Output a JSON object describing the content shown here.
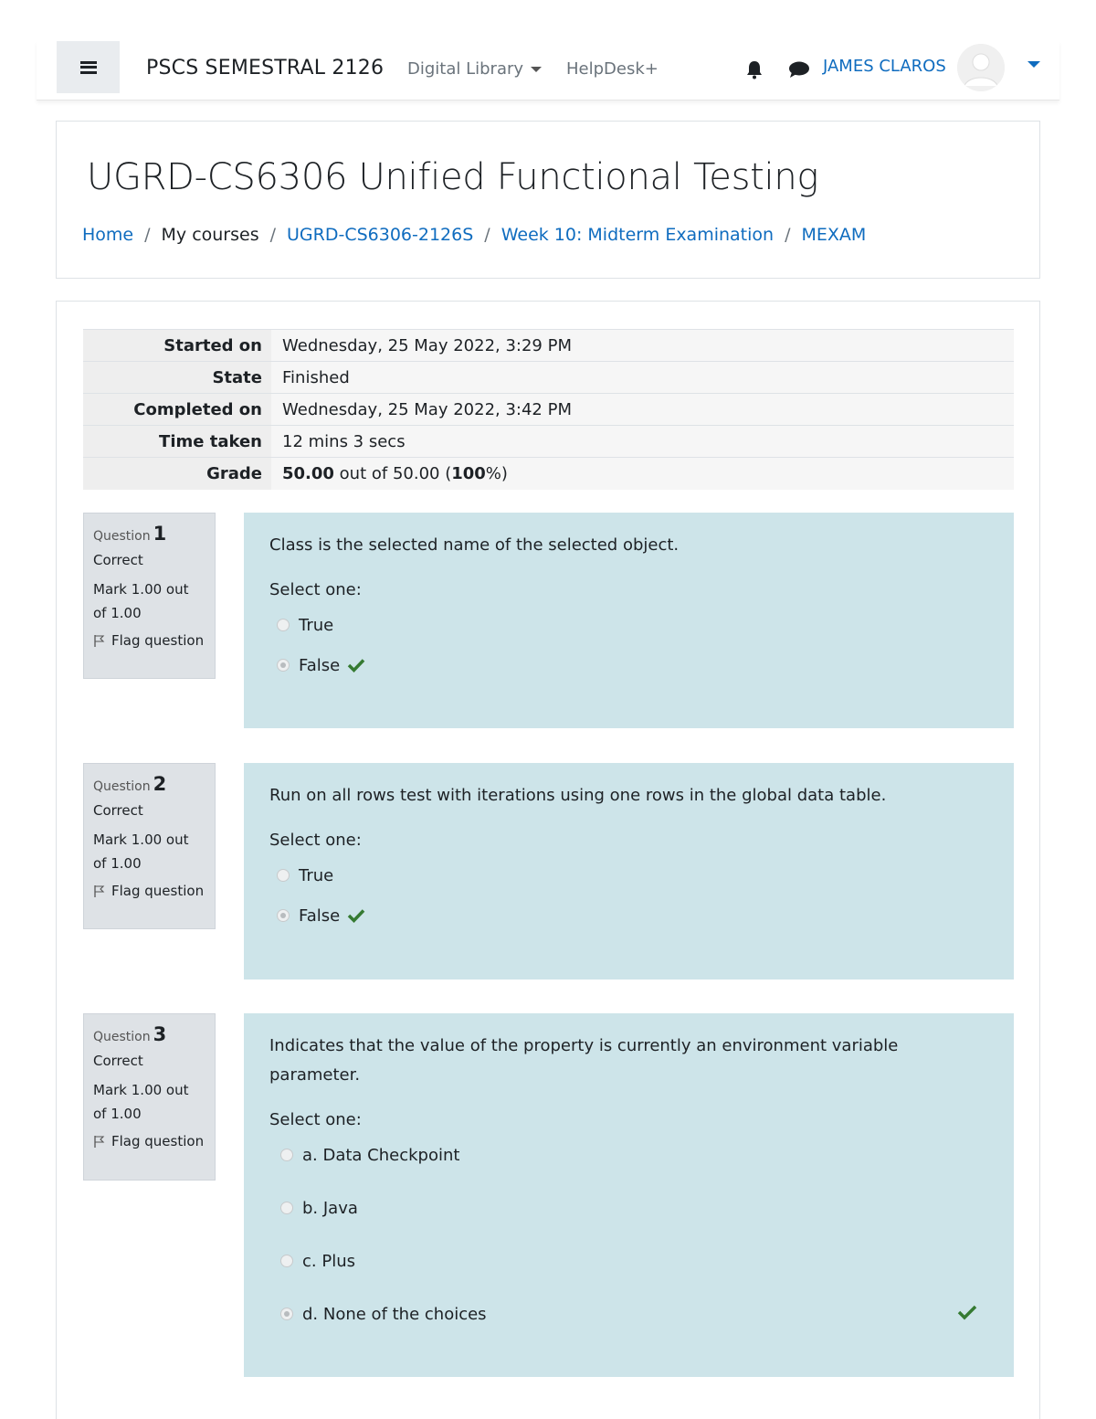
{
  "navbar": {
    "site_name": "PSCS SEMESTRAL 2126",
    "digital_library": "Digital Library",
    "helpdesk": "HelpDesk+",
    "username": "JAMES CLAROS",
    "icons": [
      "menu-icon",
      "caret-down-icon",
      "bell-icon",
      "chat-icon",
      "avatar",
      "caret-down-icon"
    ]
  },
  "header": {
    "course_title": "UGRD-CS6306 Unified Functional Testing",
    "breadcrumb": [
      "Home",
      "My courses",
      "UGRD-CS6306-2126S",
      "Week 10: Midterm Examination",
      "MEXAM"
    ]
  },
  "summary": {
    "started_on_label": "Started on",
    "started_on": "Wednesday, 25 May 2022, 3:29 PM",
    "state_label": "State",
    "state": "Finished",
    "completed_on_label": "Completed on",
    "completed_on": "Wednesday, 25 May 2022, 3:42 PM",
    "time_taken_label": "Time taken",
    "time_taken": "12 mins 3 secs",
    "grade_label": "Grade",
    "grade_value": "50.00",
    "grade_out_of": "out of 50.00 (",
    "grade_percent": "100",
    "grade_end": "%)"
  },
  "questions": [
    {
      "label": "Question",
      "number": "1",
      "state": "Correct",
      "mark": "Mark 1.00 out of 1.00",
      "flag": "Flag question",
      "text": "Class is the selected name of the selected object.",
      "prompt": "Select one:",
      "options": [
        "True",
        "False"
      ],
      "selected_index": 1
    },
    {
      "label": "Question",
      "number": "2",
      "state": "Correct",
      "mark": "Mark 1.00 out of 1.00",
      "flag": "Flag question",
      "text": "Run on all rows test with iterations using one rows in the global data table.",
      "prompt": "Select one:",
      "options": [
        "True",
        "False"
      ],
      "selected_index": 1
    },
    {
      "label": "Question",
      "number": "3",
      "state": "Correct",
      "mark": "Mark 1.00 out of 1.00",
      "flag": "Flag question",
      "text": "Indicates that the value of the property is currently an environment variable parameter.",
      "prompt": "Select one:",
      "options": [
        "a. Data Checkpoint",
        "b. Java",
        "c. Plus",
        "d. None of the choices"
      ],
      "selected_index": 3
    }
  ],
  "colors": {
    "link": "#0f6cbf",
    "question_bg": "#cde4e9",
    "info_bg": "#dee2e6",
    "correct_check": "#357a32"
  }
}
